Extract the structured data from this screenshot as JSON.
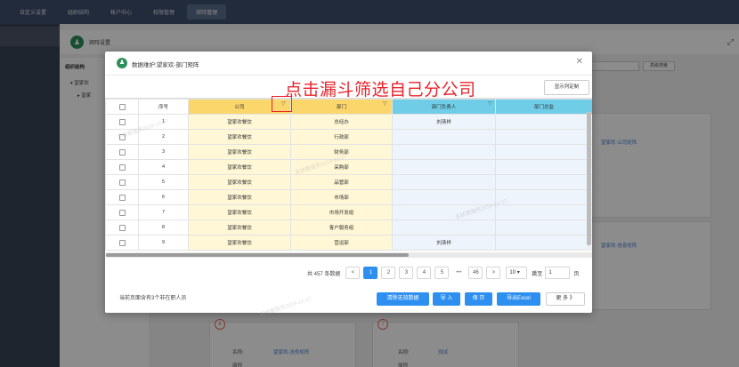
{
  "topnav": {
    "tabs": [
      "自定义设置",
      "组织结构",
      "帐户中心",
      "权限管理",
      "矩阵管理"
    ],
    "active": 4
  },
  "background": {
    "page_title": "矩阵设置",
    "tree_title": "组织结构",
    "tree_nodes": [
      "望家欢",
      "望家"
    ],
    "advanced_search": "高级搜索",
    "link1": "望家欢-公司矩阵",
    "link2": "望家欢-信息矩阵",
    "card6_num": "6",
    "card7_num": "7",
    "label_name": "名称:",
    "link3": "望家欢-法务矩阵",
    "name7": "测试",
    "label_short": "简称"
  },
  "modal": {
    "title": "数据维护:望家欢-部门矩阵",
    "annotation": "点击漏斗筛选自己分公司",
    "column_setting": "显示列定制",
    "columns": {
      "index": "序号",
      "company": "公司",
      "dept": "部门",
      "head": "部门负责人",
      "leader": "部门总监"
    },
    "rows": [
      {
        "index": "1",
        "company": "望家欢餐饮",
        "dept": "总经办",
        "head": "刘清祥"
      },
      {
        "index": "2",
        "company": "望家欢餐饮",
        "dept": "行政部",
        "head": ""
      },
      {
        "index": "3",
        "company": "望家欢餐饮",
        "dept": "财务部",
        "head": ""
      },
      {
        "index": "4",
        "company": "望家欢餐饮",
        "dept": "采购部",
        "head": ""
      },
      {
        "index": "5",
        "company": "望家欢餐饮",
        "dept": "品管部",
        "head": ""
      },
      {
        "index": "6",
        "company": "望家欢餐饮",
        "dept": "市场部",
        "head": ""
      },
      {
        "index": "7",
        "company": "望家欢餐饮",
        "dept": "市场开发组",
        "head": ""
      },
      {
        "index": "8",
        "company": "望家欢餐饮",
        "dept": "客户服务组",
        "head": ""
      },
      {
        "index": "9",
        "company": "望家欢餐饮",
        "dept": "营运部",
        "head": "刘清祥"
      }
    ],
    "pagination": {
      "total": "共 457 条数据",
      "pages": [
        "1",
        "2",
        "3",
        "4",
        "5"
      ],
      "dots": "•••",
      "last": "46",
      "page_size": "10 ▾",
      "jump_label": "跳至",
      "jump_value": "1",
      "jump_unit": "页",
      "prev": "<",
      "next": ">"
    },
    "footer_note": "当前页面含有3个非在职人员",
    "buttons": {
      "clear": "清除无效数据",
      "import": "导 入",
      "save": "保 存",
      "export": "导出Excel",
      "more": "更 多 》"
    },
    "watermark": "系统管理员2019-12-27"
  },
  "colors": {
    "accent": "#2d8ff0",
    "annotation": "#e8242c",
    "company_header": "#fad66b",
    "head_header": "#6fcde8"
  }
}
